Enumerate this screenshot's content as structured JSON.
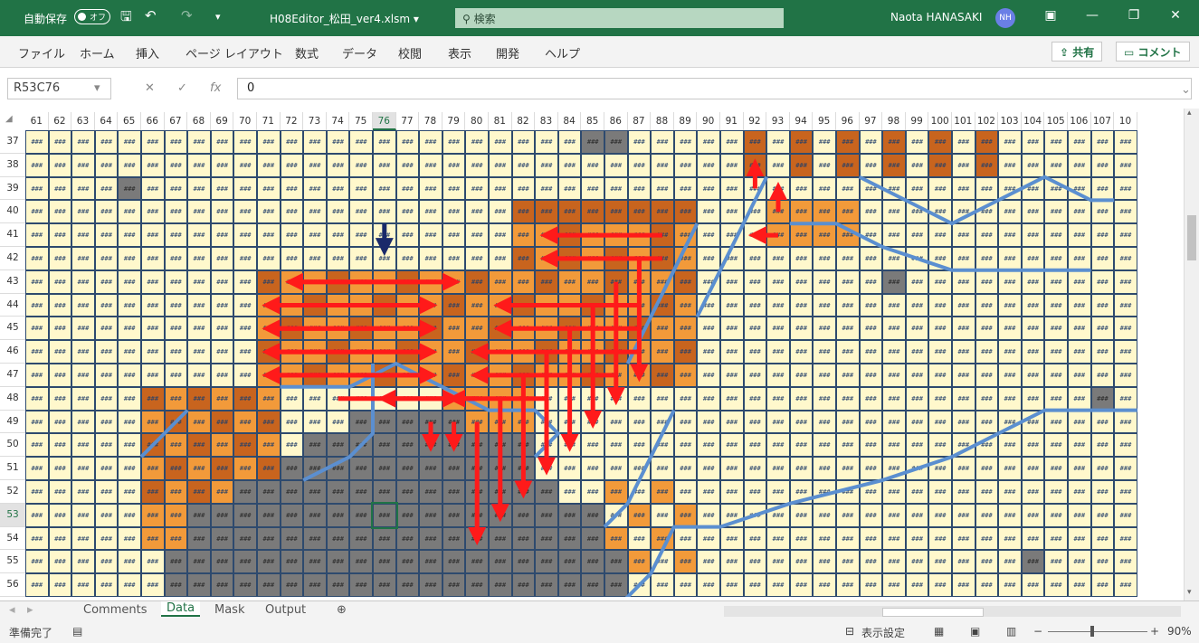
{
  "titlebar": {
    "autosave_label": "自動保存",
    "autosave_toggle": "オフ",
    "filename": "H08Editor_松田_ver4.xlsm ▾",
    "search_placeholder": "検索",
    "user_name": "Naota HANASAKI",
    "user_initials": "NH",
    "bg_color": "#217346"
  },
  "ribbon": {
    "tabs": [
      "ファイル",
      "ホーム",
      "挿入",
      "ページ レイアウト",
      "数式",
      "データ",
      "校閲",
      "表示",
      "開発",
      "ヘルプ"
    ],
    "share_label": "共有",
    "comment_label": "コメント"
  },
  "formula_bar": {
    "name_box": "R53C76",
    "fx": "fx",
    "value": "0"
  },
  "grid": {
    "col_headers": [
      "61",
      "62",
      "63",
      "64",
      "65",
      "66",
      "67",
      "68",
      "69",
      "70",
      "71",
      "72",
      "73",
      "74",
      "75",
      "76",
      "77",
      "78",
      "79",
      "80",
      "81",
      "82",
      "83",
      "84",
      "85",
      "86",
      "87",
      "88",
      "89",
      "90",
      "91",
      "92",
      "93",
      "94",
      "95",
      "96",
      "97",
      "98",
      "99",
      "100",
      "101",
      "102",
      "103",
      "104",
      "105",
      "106",
      "107",
      "10"
    ],
    "row_headers": [
      "37",
      "38",
      "39",
      "40",
      "41",
      "42",
      "43",
      "44",
      "45",
      "46",
      "47",
      "48",
      "49",
      "50",
      "51",
      "52",
      "53",
      "54",
      "55",
      "56"
    ],
    "selected_col": "76",
    "selected_row": "53",
    "cell_text": "###",
    "colors": {
      "land": "#fff8cc",
      "orange": "#f29a3a",
      "dark_orange": "#c8641e",
      "gray": "#7a7a7a",
      "river": "#5b8fd0",
      "arrow": "#ff1a1a"
    }
  },
  "sheets": {
    "tabs": [
      "Comments",
      "Data",
      "Mask",
      "Output"
    ],
    "active": "Data",
    "add_icon": "⊕"
  },
  "statusbar": {
    "ready": "準備完了",
    "display_settings": "表示設定",
    "zoom": "90%"
  }
}
